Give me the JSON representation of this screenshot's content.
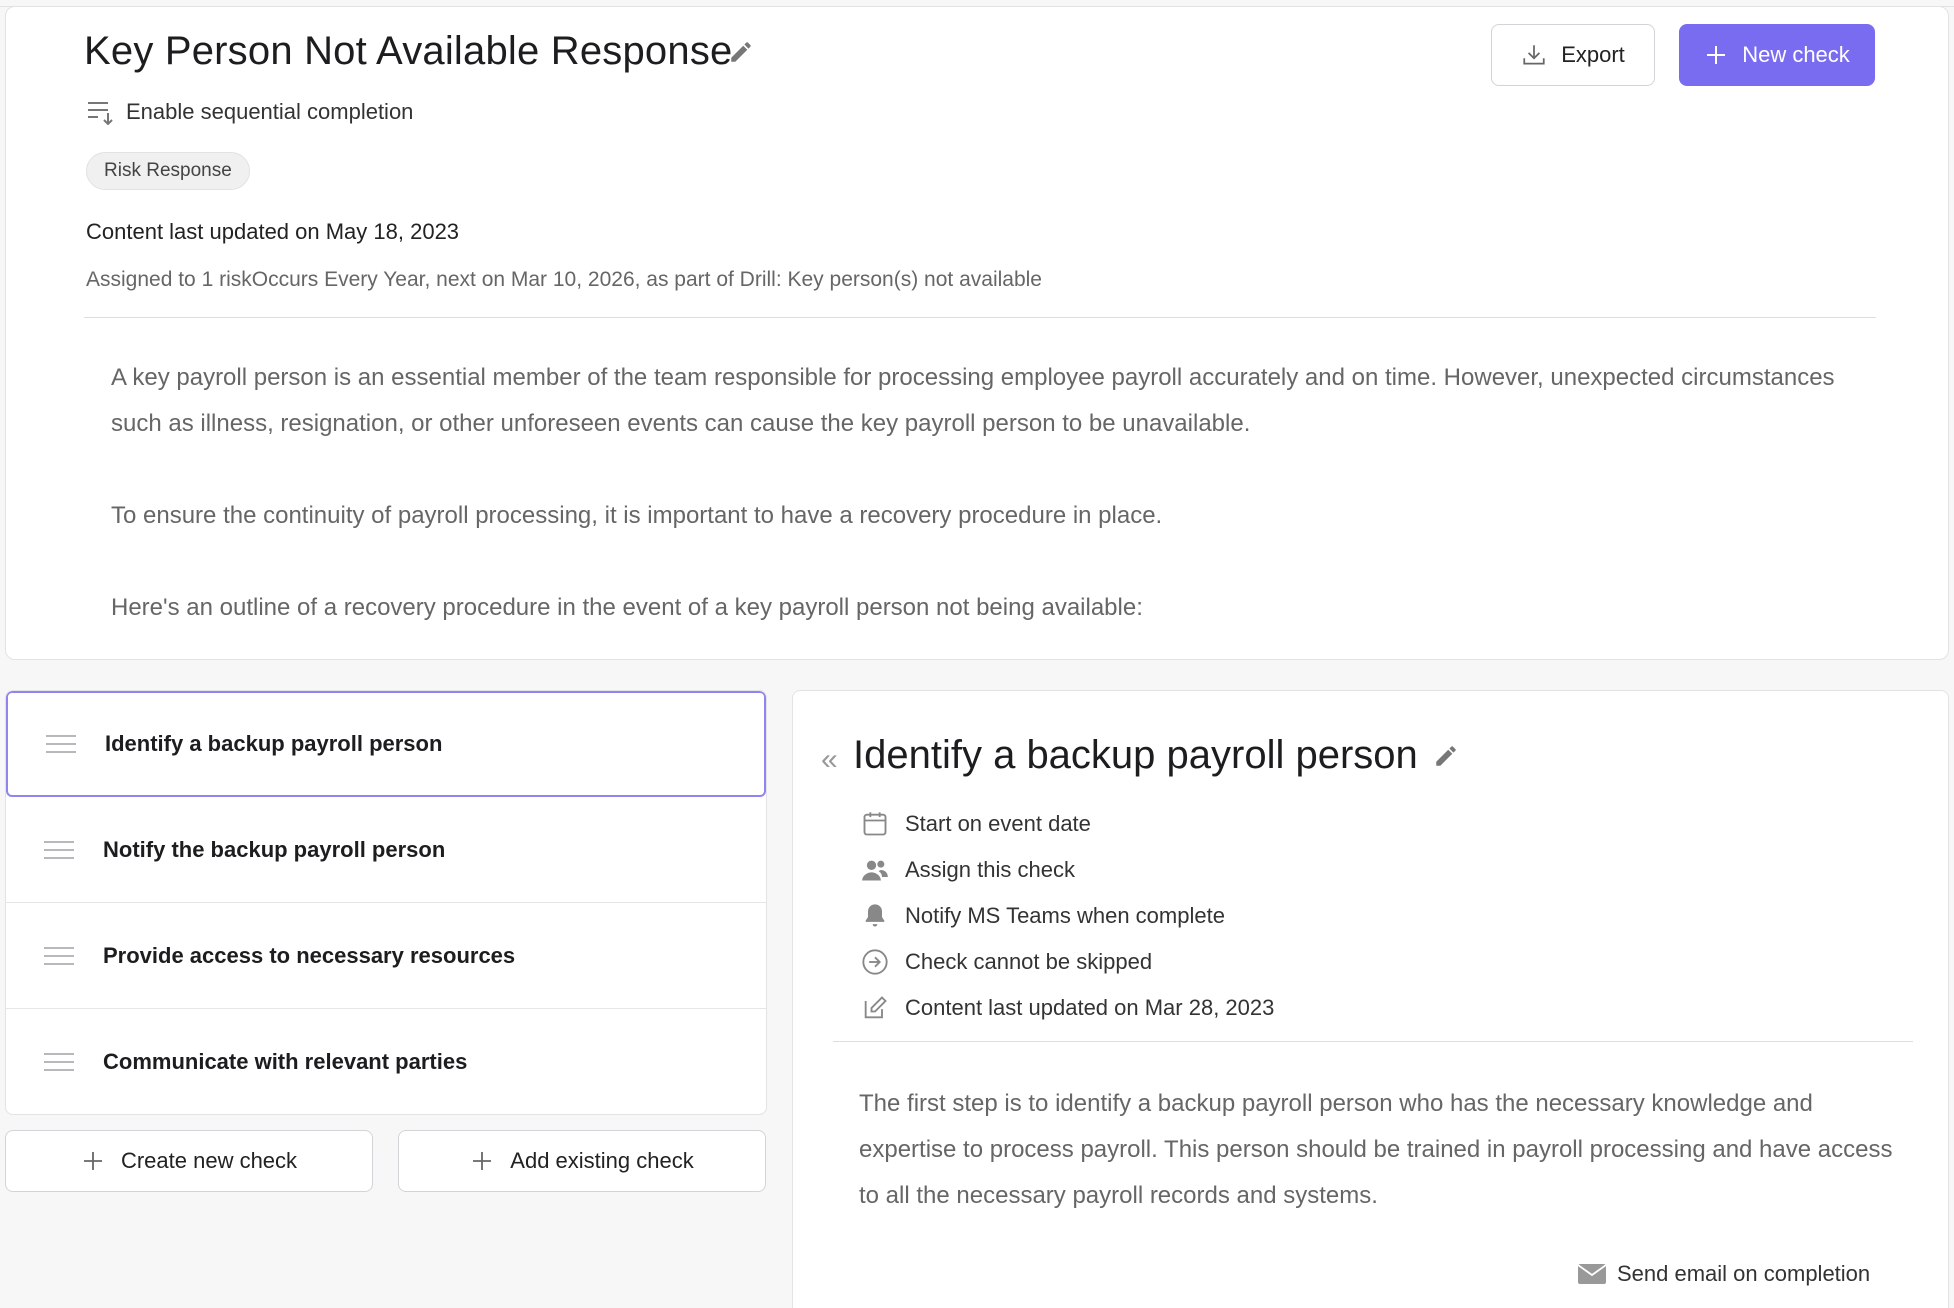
{
  "header": {
    "title": "Key Person Not Available Response",
    "sequential_label": "Enable sequential completion",
    "tag": "Risk Response",
    "content_updated": "Content last updated on May 18, 2023",
    "assigned": "Assigned to 1 riskOccurs Every Year, next on Mar 10, 2026, as part of Drill: Key person(s) not available",
    "export_label": "Export",
    "new_check_label": "New check",
    "accent_color": "#7a6cf0"
  },
  "description": {
    "paragraphs": [
      "A key payroll person is an essential member of the team responsible for processing employee payroll accurately and on time. However, unexpected circumstances such as illness, resignation, or other unforeseen events can cause the key payroll person to be unavailable.",
      "To ensure the continuity of payroll processing, it is important to have a recovery procedure in place.",
      "Here's an outline of a recovery procedure in the event of a key payroll person not being available:"
    ]
  },
  "checks": [
    {
      "label": "Identify a backup payroll person",
      "active": true
    },
    {
      "label": "Notify the backup payroll person",
      "active": false
    },
    {
      "label": "Provide access to necessary resources",
      "active": false
    },
    {
      "label": "Communicate with relevant parties",
      "active": false
    }
  ],
  "actions": {
    "create_label": "Create new check",
    "add_existing_label": "Add existing check"
  },
  "detail": {
    "title": "Identify a backup payroll person",
    "meta": [
      {
        "icon": "calendar-icon",
        "label": "Start on event date"
      },
      {
        "icon": "users-icon",
        "label": "Assign this check"
      },
      {
        "icon": "bell-icon",
        "label": "Notify MS Teams when complete"
      },
      {
        "icon": "skip-arrow-icon",
        "label": "Check cannot be skipped"
      },
      {
        "icon": "edit-square-icon",
        "label": "Content last updated on Mar 28, 2023"
      }
    ],
    "description": "The first step is to identify a backup payroll person who has the necessary knowledge and expertise to process payroll. This person should be trained in payroll processing and have access to all the necessary payroll records and systems.",
    "send_email_label": "Send email on completion"
  }
}
